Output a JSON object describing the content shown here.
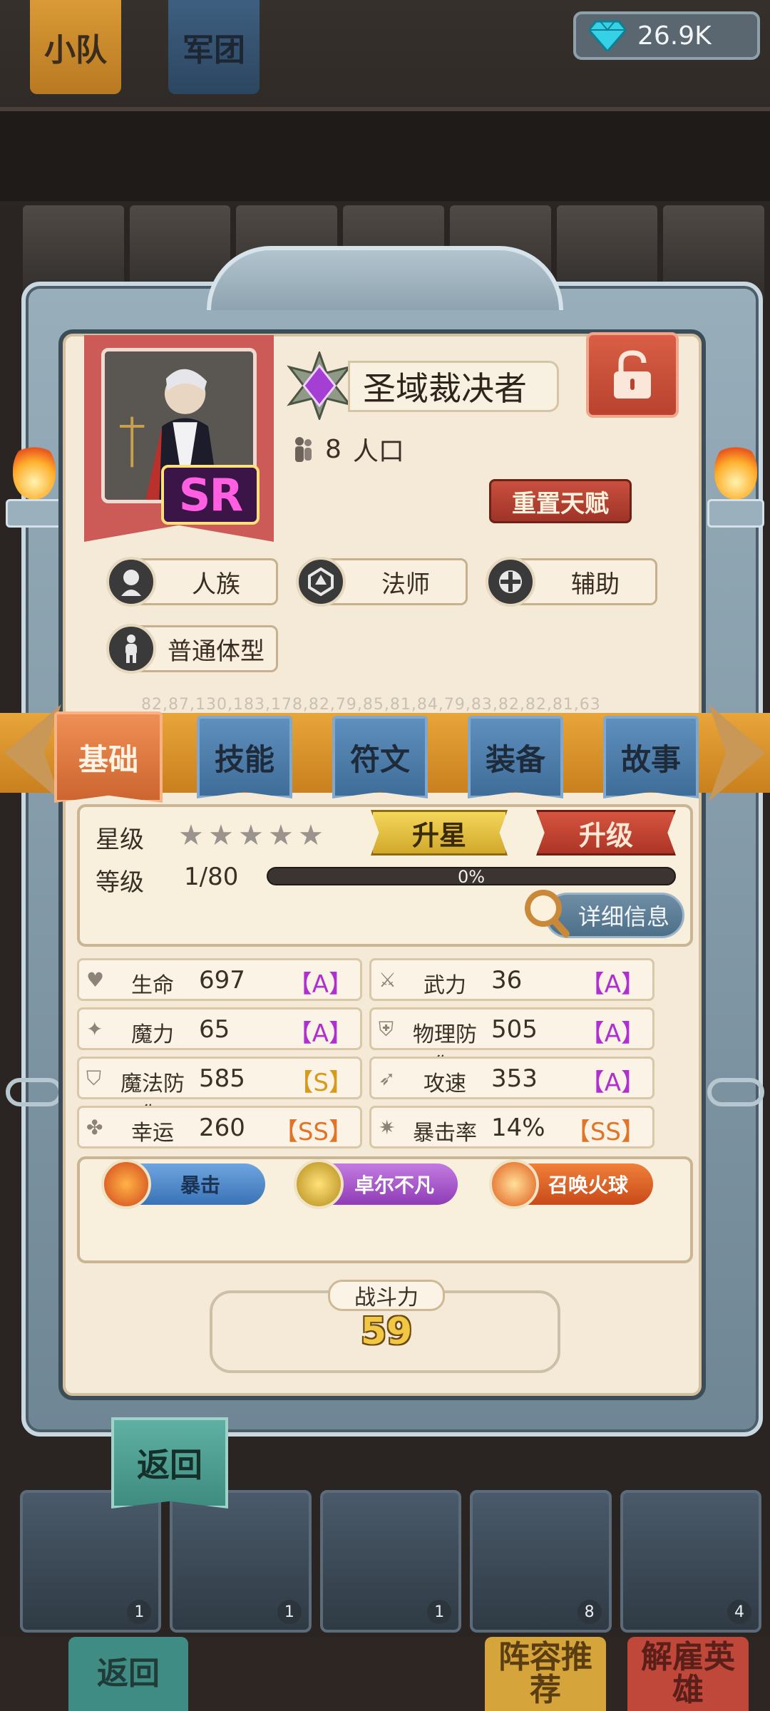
{
  "top_tabs": {
    "squad": "小队",
    "legion": "军团"
  },
  "currency": {
    "icon": "diamond-icon",
    "amount": "26.9K"
  },
  "hero": {
    "name": "圣域裁决者",
    "rarity": "SR",
    "population_value": "8",
    "population_label": "人口",
    "reset_talent_label": "重置天赋",
    "tags": {
      "race": "人族",
      "class": "法师",
      "role": "辅助",
      "body": "普通体型"
    }
  },
  "debug_numbers": "82,87,130,183,178,82,79,85,81,84,79,83,82,82,81,63",
  "tabs": {
    "basic": "基础",
    "skills": "技能",
    "runes": "符文",
    "equipment": "装备",
    "story": "故事",
    "active": "基础"
  },
  "progress": {
    "star_label": "星级",
    "stars_filled": 0,
    "stars_total": 5,
    "level_label": "等级",
    "level_value": "1/80",
    "xp_fraction": 0,
    "xp_text": "0%",
    "star_up_label": "升星",
    "level_up_label": "升级",
    "details_label": "详细信息"
  },
  "stats": [
    {
      "name": "生命",
      "value": "697",
      "grade": "【A】"
    },
    {
      "name": "武力",
      "value": "36",
      "grade": "【A】"
    },
    {
      "name": "魔力",
      "value": "65",
      "grade": "【A】"
    },
    {
      "name": "物理防御",
      "value": "505",
      "grade": "【A】"
    },
    {
      "name": "魔法防御",
      "value": "585",
      "grade": "【S】"
    },
    {
      "name": "攻速",
      "value": "353",
      "grade": "【A】"
    },
    {
      "name": "幸运",
      "value": "260",
      "grade": "【SS】"
    },
    {
      "name": "暴击率",
      "value": "14%",
      "grade": "【SS】"
    }
  ],
  "skills": [
    "暴击",
    "卓尔不凡",
    "召唤火球"
  ],
  "power": {
    "label": "战斗力",
    "value": "59"
  },
  "back_label": "返回",
  "bottom_bar": {
    "back": "返回",
    "lineup": "阵容推荐",
    "dismiss": "解雇英雄"
  },
  "roster_levels": [
    "1",
    "1",
    "1",
    "8",
    "4"
  ],
  "colors": {
    "grade_a": "#b02fd0",
    "grade_s": "#d89a1a",
    "grade_ss": "#e0752a",
    "accent_tab": "#cd6530"
  }
}
